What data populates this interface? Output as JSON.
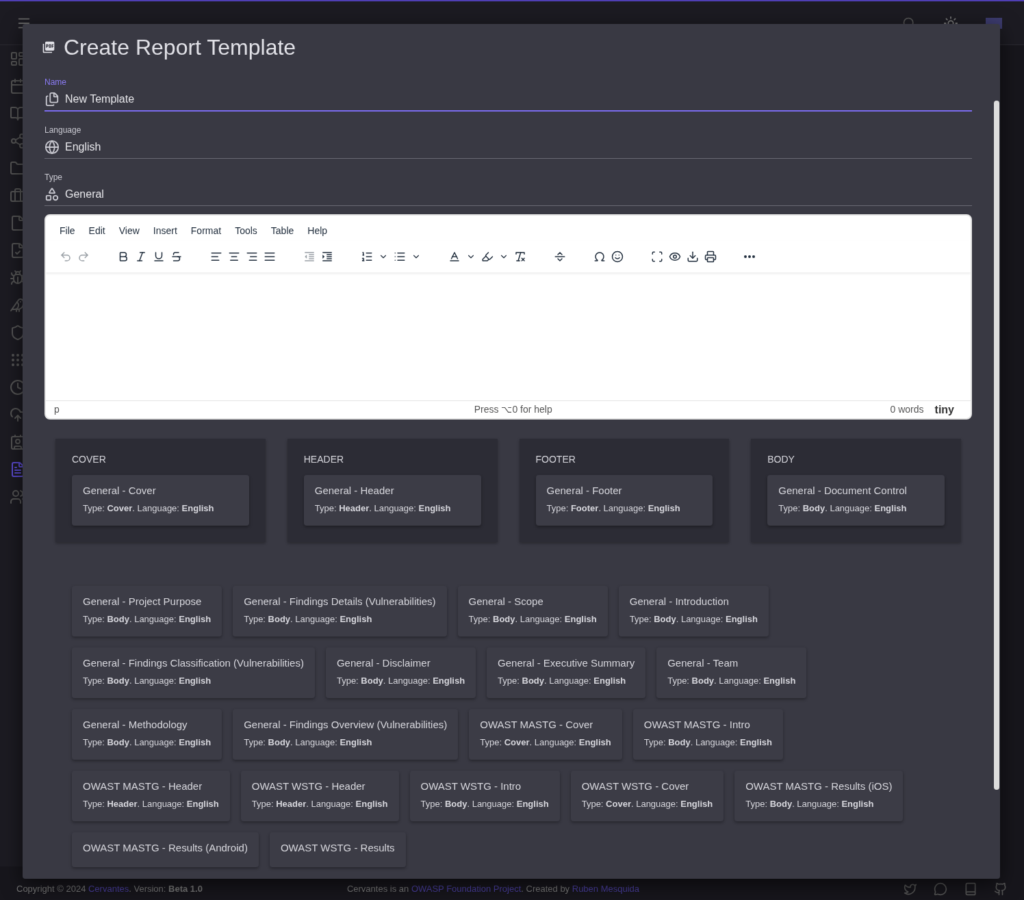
{
  "nav": [
    {
      "selected": false
    },
    {
      "selected": false
    },
    {
      "selected": false
    },
    {
      "selected": false
    },
    {
      "selected": false
    },
    {
      "selected": false
    },
    {
      "selected": false
    },
    {
      "selected": false
    },
    {
      "selected": false
    },
    {
      "selected": false
    },
    {
      "selected": false
    },
    {
      "selected": false
    },
    {
      "selected": false
    },
    {
      "selected": false
    },
    {
      "selected": false
    },
    {
      "selected": true
    },
    {
      "selected": false
    }
  ],
  "dialog": {
    "title": "Create Report Template",
    "fields": [
      {
        "kind": "name",
        "label": "Name",
        "value": "New Template",
        "focused": true
      },
      {
        "kind": "language",
        "label": "Language",
        "value": "English",
        "focused": false
      },
      {
        "kind": "type",
        "label": "Type",
        "value": "General",
        "focused": false
      }
    ],
    "editor": {
      "menu": [
        "File",
        "Edit",
        "View",
        "Insert",
        "Format",
        "Tools",
        "Table",
        "Help"
      ],
      "history": [
        {
          "disabled": true
        },
        {
          "disabled": true
        }
      ],
      "status_path": "p",
      "help": "Press ⌥0 for help",
      "word_count": "0 words",
      "brand": "tiny"
    },
    "sections": [
      {
        "title": "COVER",
        "templates": [
          {
            "name": "General - Cover",
            "meta": "Type: **Cover**. Language: **English**"
          }
        ]
      },
      {
        "title": "HEADER",
        "templates": [
          {
            "name": "General - Header",
            "meta": "Type: **Header**. Language: **English**"
          }
        ]
      },
      {
        "title": "FOOTER",
        "templates": [
          {
            "name": "General - Footer",
            "meta": "Type: **Footer**. Language: **English**"
          }
        ]
      },
      {
        "title": "BODY",
        "templates": [
          {
            "name": "General - Document Control",
            "meta": "Type: **Body**. Language: **English**"
          }
        ]
      }
    ],
    "available_templates": [
      {
        "name": "General - Project Purpose",
        "meta": "Type: **Body**. Language: **English**"
      },
      {
        "name": "General - Findings Details (Vulnerabilities)",
        "meta": "Type: **Body**. Language: **English**"
      },
      {
        "name": "General - Scope",
        "meta": "Type: **Body**. Language: **English**"
      },
      {
        "name": "General - Introduction",
        "meta": "Type: **Body**. Language: **English**"
      },
      {
        "name": "General - Findings Classification (Vulnerabilities)",
        "meta": "Type: **Body**. Language: **English**"
      },
      {
        "name": "General - Disclaimer",
        "meta": "Type: **Body**. Language: **English**"
      },
      {
        "name": "General - Executive Summary",
        "meta": "Type: **Body**. Language: **English**"
      },
      {
        "name": "General - Team",
        "meta": "Type: **Body**. Language: **English**"
      },
      {
        "name": "General - Methodology",
        "meta": "Type: **Body**. Language: **English**"
      },
      {
        "name": "General - Findings Overview (Vulnerabilities)",
        "meta": "Type: **Body**. Language: **English**"
      },
      {
        "name": "OWAST MASTG - Cover",
        "meta": "Type: **Cover**. Language: **English**"
      },
      {
        "name": "OWAST MASTG - Intro",
        "meta": "Type: **Body**. Language: **English**"
      },
      {
        "name": "OWAST MASTG - Header",
        "meta": "Type: **Header**. Language: **English**"
      },
      {
        "name": "OWAST WSTG - Header",
        "meta": "Type: **Header**. Language: **English**"
      },
      {
        "name": "OWAST WSTG - Intro",
        "meta": "Type: **Body**. Language: **English**"
      },
      {
        "name": "OWAST WSTG - Cover",
        "meta": "Type: **Cover**. Language: **English**"
      },
      {
        "name": "OWAST MASTG - Results (iOS)",
        "meta": "Type: **Body**. Language: **English**"
      },
      {
        "name": "OWAST MASTG - Results (Android)"
      },
      {
        "name": "OWAST WSTG - Results"
      }
    ]
  },
  "footer": {
    "copyright": "Copyright © 2024",
    "app_link": "Cervantes",
    "version": ". Version: **Beta 1.0**",
    "about_before": "Cervantes is an",
    "foundation_link": "OWASP Foundation Project",
    "about_middle": ". Created by",
    "author_link": "Ruben Mesquida"
  }
}
